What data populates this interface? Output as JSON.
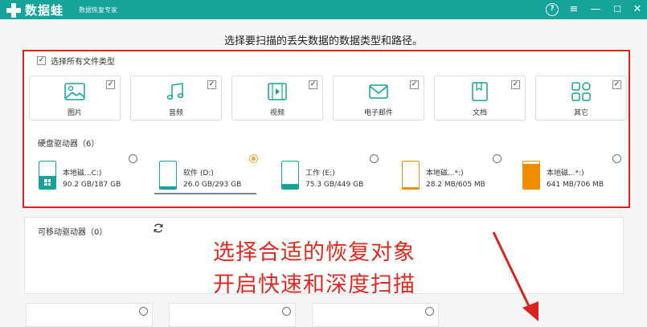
{
  "app": {
    "name": "数据蛙",
    "subtitle": "数据恢复专家"
  },
  "window_controls": {
    "help": "?",
    "menu": "≡",
    "minimize": "—",
    "maximize": "☐",
    "close": "✕"
  },
  "heading": "选择要扫描的丢失数据的数据类型和路径。",
  "select_all": {
    "label": "选择所有文件类型",
    "checked": true
  },
  "file_types": [
    {
      "label": "图片",
      "icon": "image-icon",
      "checked": true
    },
    {
      "label": "音频",
      "icon": "music-icon",
      "checked": true
    },
    {
      "label": "视频",
      "icon": "video-icon",
      "checked": true
    },
    {
      "label": "电子邮件",
      "icon": "mail-icon",
      "checked": true
    },
    {
      "label": "文档",
      "icon": "document-icon",
      "checked": true
    },
    {
      "label": "其它",
      "icon": "other-icon",
      "checked": true
    }
  ],
  "hard_drives": {
    "title": "硬盘驱动器（6）",
    "items": [
      {
        "name": "本地磁...C:)",
        "size": "90.2 GB/187 GB",
        "used_fraction": 0.48,
        "color": "#17a39a",
        "selected": false,
        "windows": true
      },
      {
        "name": "软件 (D:)",
        "size": "26.0 GB/293 GB",
        "used_fraction": 0.09,
        "color": "#17a39a",
        "selected": true,
        "windows": false
      },
      {
        "name": "工作 (E:)",
        "size": "75.3 GB/449 GB",
        "used_fraction": 0.17,
        "color": "#17a39a",
        "selected": false,
        "windows": false
      },
      {
        "name": "本地磁...*:)",
        "size": "28.2 MB/605 MB",
        "used_fraction": 0.05,
        "color": "#f08c00",
        "selected": false,
        "windows": false
      },
      {
        "name": "本地磁...*:)",
        "size": "641 MB/706 MB",
        "used_fraction": 0.91,
        "color": "#f08c00",
        "selected": false,
        "windows": false
      }
    ]
  },
  "removable": {
    "title": "可移动驱动器（0）"
  },
  "annotation": {
    "line1": "选择合适的恢复对象",
    "line2": "开启快速和深度扫描"
  },
  "colors": {
    "brand": "#15a39a",
    "highlight": "#d9241c",
    "warning_drive": "#f08c00"
  }
}
